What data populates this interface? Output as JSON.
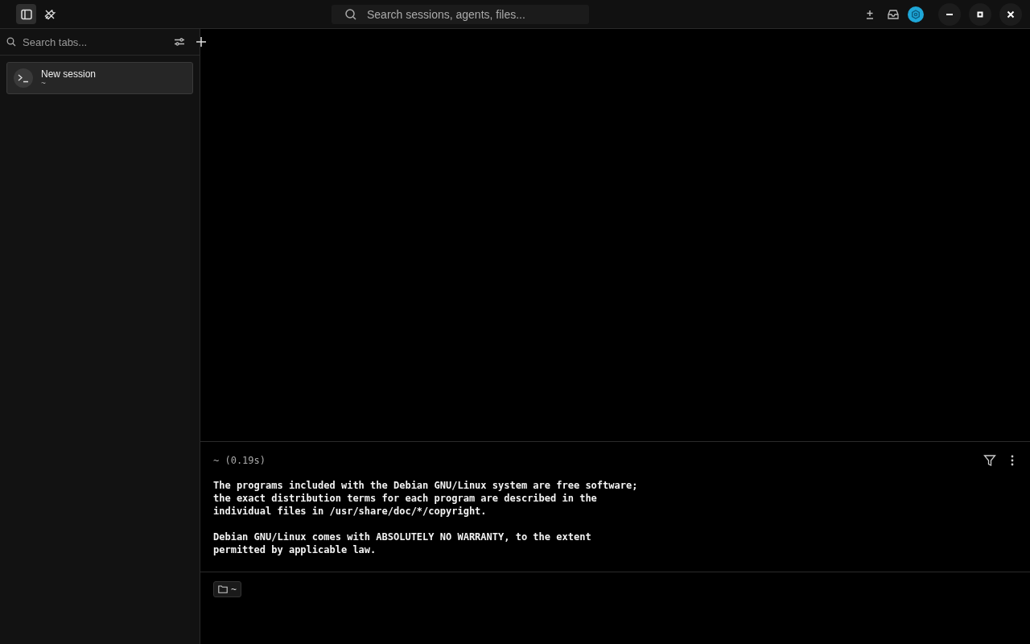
{
  "title_bar": {
    "toolbar": [
      {
        "kind": "sidebar",
        "selected": true
      },
      {
        "kind": "tools",
        "selected": false
      }
    ],
    "search": {
      "placeholder": "Search sessions, agents, files..."
    }
  },
  "sidebar": {
    "search": {
      "placeholder": "Search tabs..."
    },
    "sessions": [
      {
        "title": "New session",
        "subtitle": "~",
        "selected": true
      }
    ]
  },
  "block": {
    "header": "~ (0.19s)",
    "paragraphs": [
      [
        "The programs included with the Debian GNU/Linux system are free software;",
        "the exact distribution terms for each program are described in the",
        "individual files in /usr/share/doc/*/copyright."
      ],
      [
        "Debian GNU/Linux comes with ABSOLUTELY NO WARRANTY, to the extent",
        "permitted by applicable law."
      ]
    ]
  },
  "input": {
    "directory": "~"
  }
}
